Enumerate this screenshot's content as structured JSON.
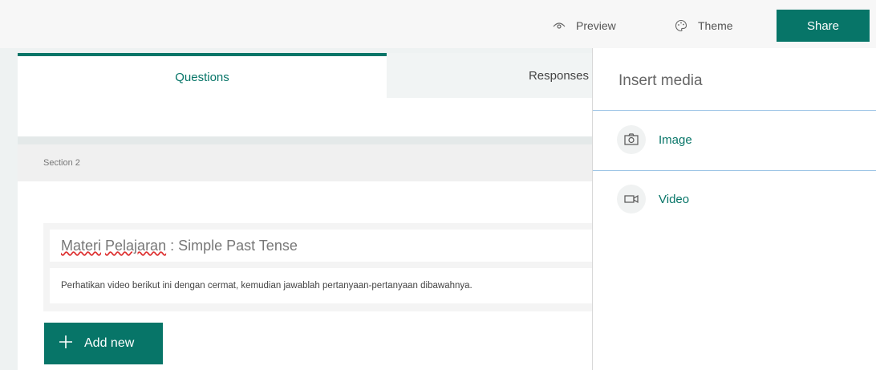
{
  "topbar": {
    "preview_label": "Preview",
    "theme_label": "Theme",
    "share_label": "Share"
  },
  "tabs": {
    "questions": "Questions",
    "responses": "Responses"
  },
  "section": {
    "label": "Section 2"
  },
  "question": {
    "title_word1": "Materi",
    "title_word2": "Pelajaran",
    "title_rest": " : Simple Past Tense",
    "description": "Perhatikan video berikut ini dengan cermat, kemudian jawablah pertanyaan-pertanyaan dibawahnya."
  },
  "add_new_label": "Add new",
  "media_panel": {
    "title": "Insert media",
    "items": [
      {
        "label": "Image",
        "icon": "camera-icon"
      },
      {
        "label": "Video",
        "icon": "video-icon"
      }
    ]
  },
  "colors": {
    "accent": "#077568",
    "divider": "#9ec5e6"
  }
}
